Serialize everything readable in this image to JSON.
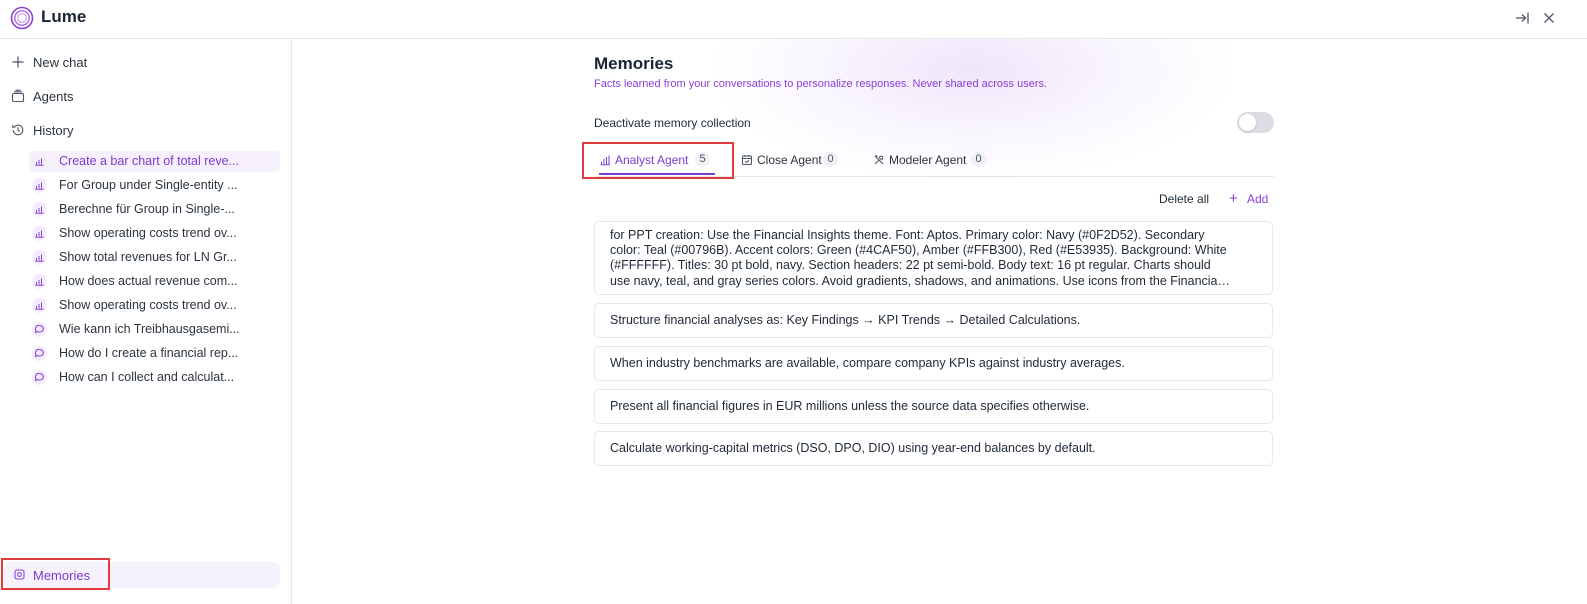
{
  "app": {
    "title": "Lume",
    "logo_icon": "lume-logo-icon",
    "accent": "#7e3bd0",
    "header_buttons": [
      "collapse-panel-icon",
      "close-icon"
    ]
  },
  "sidebar": {
    "nav": [
      {
        "label": "New chat",
        "icon": "plus-icon"
      },
      {
        "label": "Agents",
        "icon": "agents-icon"
      },
      {
        "label": "History",
        "icon": "history-icon"
      }
    ],
    "history": [
      {
        "label": "Create a bar chart of total reve...",
        "icon": "chart-icon",
        "active": true
      },
      {
        "label": "For Group under Single-entity ...",
        "icon": "chart-icon",
        "active": false
      },
      {
        "label": "Berechne für Group in Single-...",
        "icon": "chart-icon",
        "active": false
      },
      {
        "label": "Show operating costs trend ov...",
        "icon": "chart-icon",
        "active": false
      },
      {
        "label": "Show total revenues for LN Gr...",
        "icon": "chart-icon",
        "active": false
      },
      {
        "label": "How does actual revenue com...",
        "icon": "chart-icon",
        "active": false
      },
      {
        "label": "Show operating costs trend ov...",
        "icon": "chart-icon",
        "active": false
      },
      {
        "label": "Wie kann ich Treibhausgasemi...",
        "icon": "chat-bubble-icon",
        "active": false
      },
      {
        "label": "How do I create a financial rep...",
        "icon": "chat-bubble-icon",
        "active": false
      },
      {
        "label": "How can I collect and calculat...",
        "icon": "chat-bubble-icon",
        "active": false
      }
    ],
    "memories": {
      "label": "Memories",
      "icon": "memory-chip-icon"
    }
  },
  "main": {
    "title": "Memories",
    "subtitle": "Facts learned from your conversations to personalize responses. Never shared across users.",
    "toggle": {
      "label": "Deactivate memory collection",
      "on": false
    },
    "tabs": [
      {
        "label": "Analyst Agent",
        "count": "5",
        "icon": "chart-icon",
        "active": true
      },
      {
        "label": "Close Agent",
        "count": "0",
        "icon": "calendar-check-icon",
        "active": false
      },
      {
        "label": "Modeler Agent",
        "count": "0",
        "icon": "tools-icon",
        "active": false
      }
    ],
    "actions": {
      "delete_all": "Delete all",
      "add": "Add"
    },
    "memories": [
      "for PPT creation: Use the Financial Insights theme. Font: Aptos. Primary color: Navy (#0F2D52). Secondary color: Teal (#00796B). Accent colors: Green (#4CAF50), Amber (#FFB300), Red (#E53935). Background: White (#FFFFFF). Titles: 30 pt bold, navy. Section headers: 22 pt semi-bold. Body text: 16 pt regular. Charts should use navy, teal, and gray series colors. Avoid gradients, shadows, and animations. Use icons from the Financial Insights library.",
      "Structure financial analyses as: Key Findings → KPI Trends → Detailed Calculations.",
      "When industry benchmarks are available, compare company KPIs against industry averages.",
      "Present all financial figures in EUR millions unless the source data specifies otherwise.",
      "Calculate working-capital metrics (DSO, DPO, DIO) using year-end balances by default."
    ]
  }
}
